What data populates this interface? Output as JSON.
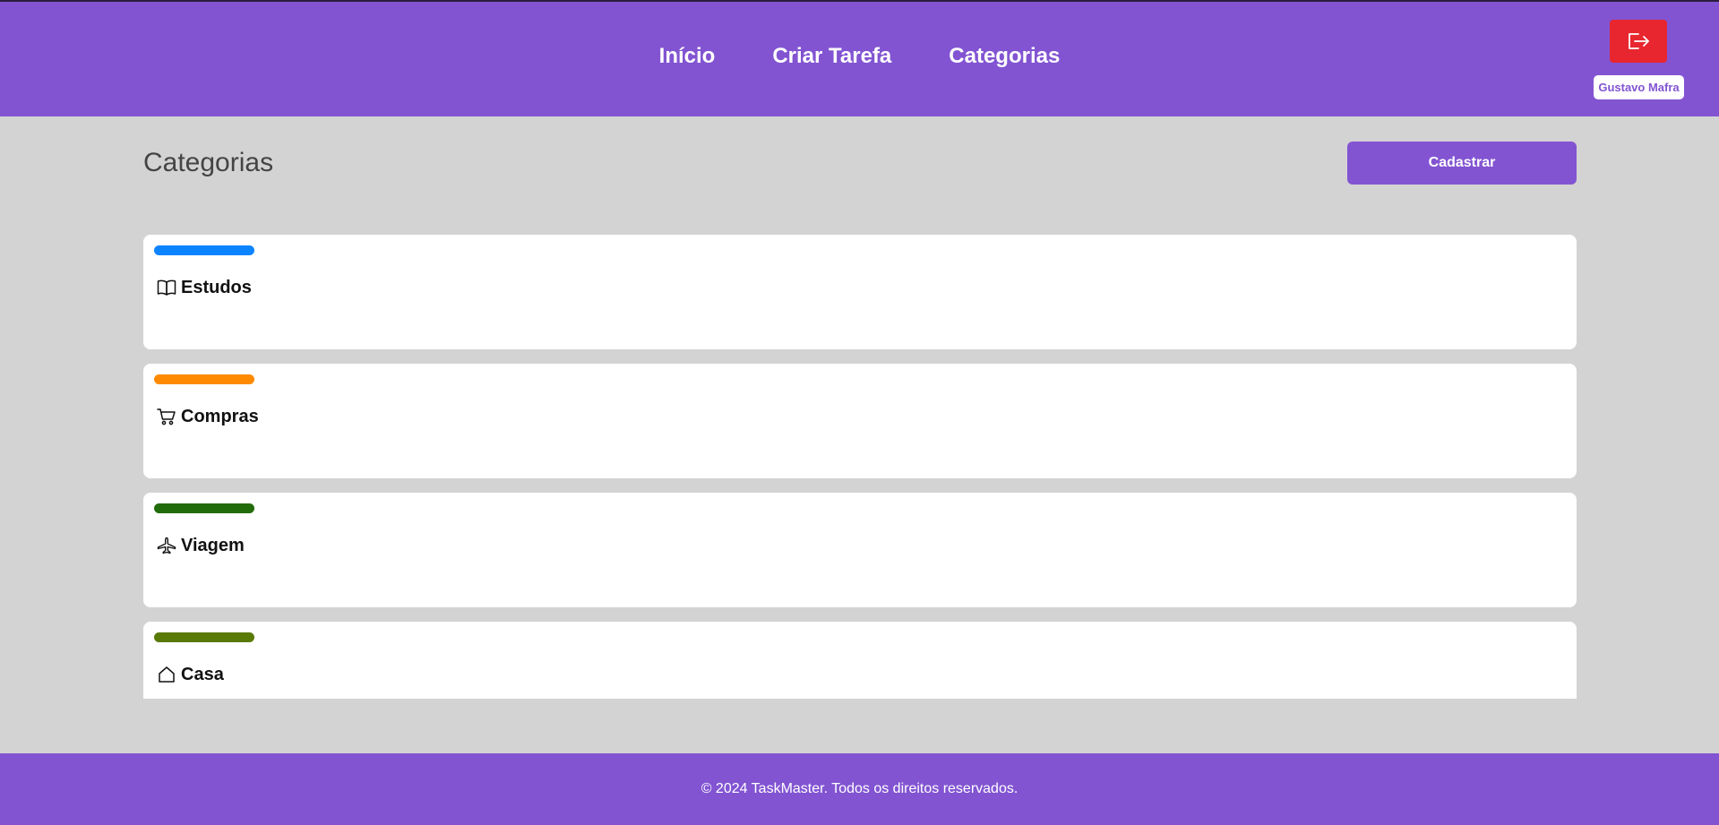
{
  "nav": {
    "items": [
      {
        "label": "Início"
      },
      {
        "label": "Criar Tarefa"
      },
      {
        "label": "Categorias"
      }
    ]
  },
  "user": {
    "name": "Gustavo Mafra",
    "logout_icon": "logout-icon"
  },
  "page": {
    "title": "Categorias",
    "register_label": "Cadastrar"
  },
  "categories": [
    {
      "name": "Estudos",
      "color": "#0d84ff",
      "icon": "book-icon"
    },
    {
      "name": "Compras",
      "color": "#ff8a00",
      "icon": "cart-icon"
    },
    {
      "name": "Viagem",
      "color": "#226b0b",
      "icon": "airplane-icon"
    },
    {
      "name": "Casa",
      "color": "#5a7a07",
      "icon": "house-icon"
    }
  ],
  "footer": {
    "text": "© 2024 TaskMaster. Todos os direitos reservados."
  },
  "colors": {
    "brand": "#8254d2",
    "logout": "#e8262f",
    "background": "#d3d3d3"
  }
}
